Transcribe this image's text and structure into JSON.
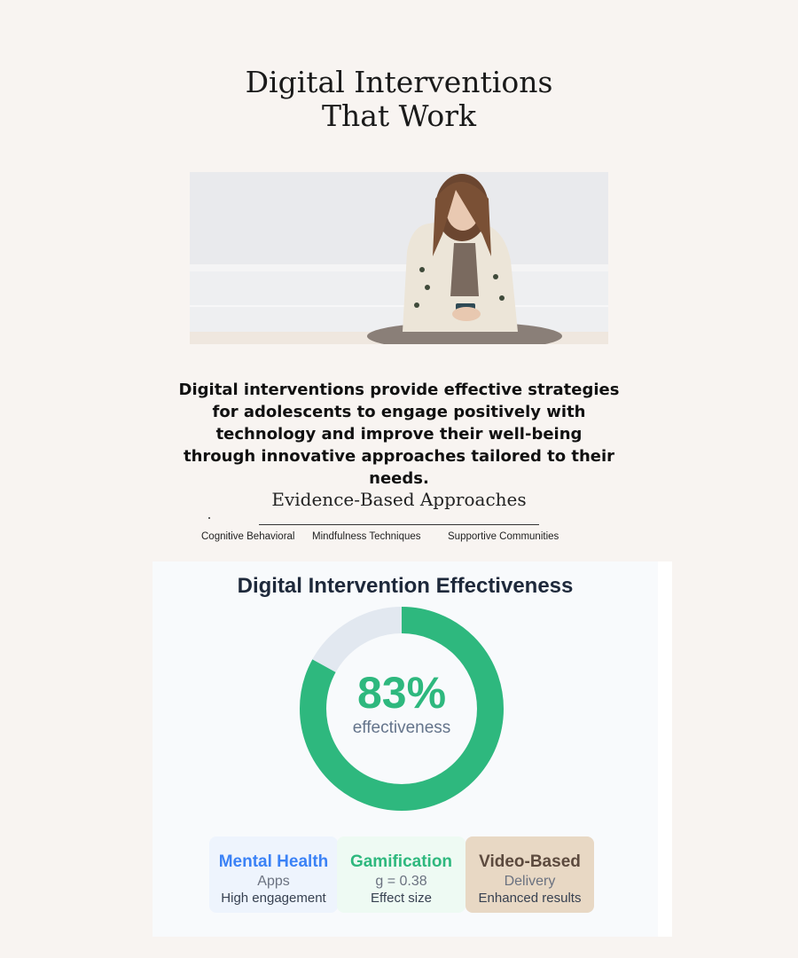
{
  "page": {
    "title_line1": "Digital Interventions",
    "title_line2": "That Work",
    "lead": "Digital interventions provide effective strategies for adolescents to engage positively with technology and improve their well-being through innovative approaches tailored to their needs.",
    "subheading": "Evidence-Based Approaches",
    "approaches": [
      "Cognitive Behavioral",
      "Mindfulness Techniques",
      "Supportive Communities"
    ]
  },
  "card": {
    "title": "Digital Intervention Effectiveness",
    "effectiveness_value": "83%",
    "effectiveness_fraction": 0.83,
    "effectiveness_label": "effectiveness",
    "colors": {
      "ring": "#2eb87e",
      "track": "#e2e8f0"
    },
    "tiles": [
      {
        "title": "Mental Health",
        "line2": "Apps",
        "line3": "High engagement",
        "color": "#3b82f6",
        "bg": "#eef4fd"
      },
      {
        "title": "Gamification",
        "line2": "g = 0.38",
        "line3": "Effect size",
        "color": "#2eb87e",
        "bg": "#eefaf3"
      },
      {
        "title": "Video-Based",
        "line2": "Delivery",
        "line3": "Enhanced results",
        "color": "#5c4a3e",
        "bg": "#e8d8c4"
      }
    ]
  }
}
